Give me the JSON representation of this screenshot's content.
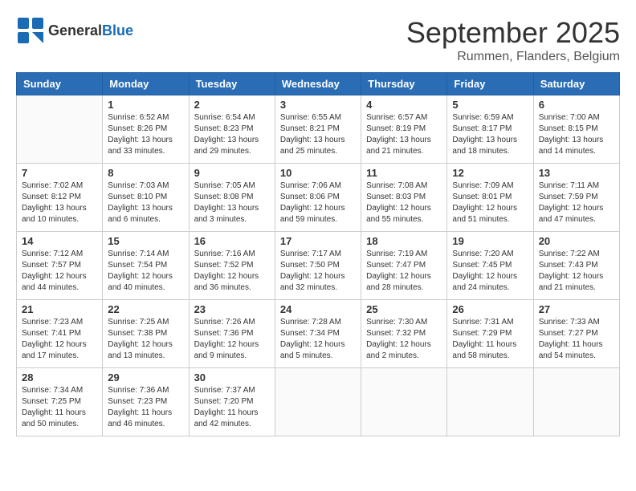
{
  "header": {
    "logo_line1": "General",
    "logo_line2": "Blue",
    "month": "September 2025",
    "location": "Rummen, Flanders, Belgium"
  },
  "columns": [
    "Sunday",
    "Monday",
    "Tuesday",
    "Wednesday",
    "Thursday",
    "Friday",
    "Saturday"
  ],
  "weeks": [
    [
      {
        "day": "",
        "info": ""
      },
      {
        "day": "1",
        "info": "Sunrise: 6:52 AM\nSunset: 8:26 PM\nDaylight: 13 hours\nand 33 minutes."
      },
      {
        "day": "2",
        "info": "Sunrise: 6:54 AM\nSunset: 8:23 PM\nDaylight: 13 hours\nand 29 minutes."
      },
      {
        "day": "3",
        "info": "Sunrise: 6:55 AM\nSunset: 8:21 PM\nDaylight: 13 hours\nand 25 minutes."
      },
      {
        "day": "4",
        "info": "Sunrise: 6:57 AM\nSunset: 8:19 PM\nDaylight: 13 hours\nand 21 minutes."
      },
      {
        "day": "5",
        "info": "Sunrise: 6:59 AM\nSunset: 8:17 PM\nDaylight: 13 hours\nand 18 minutes."
      },
      {
        "day": "6",
        "info": "Sunrise: 7:00 AM\nSunset: 8:15 PM\nDaylight: 13 hours\nand 14 minutes."
      }
    ],
    [
      {
        "day": "7",
        "info": "Sunrise: 7:02 AM\nSunset: 8:12 PM\nDaylight: 13 hours\nand 10 minutes."
      },
      {
        "day": "8",
        "info": "Sunrise: 7:03 AM\nSunset: 8:10 PM\nDaylight: 13 hours\nand 6 minutes."
      },
      {
        "day": "9",
        "info": "Sunrise: 7:05 AM\nSunset: 8:08 PM\nDaylight: 13 hours\nand 3 minutes."
      },
      {
        "day": "10",
        "info": "Sunrise: 7:06 AM\nSunset: 8:06 PM\nDaylight: 12 hours\nand 59 minutes."
      },
      {
        "day": "11",
        "info": "Sunrise: 7:08 AM\nSunset: 8:03 PM\nDaylight: 12 hours\nand 55 minutes."
      },
      {
        "day": "12",
        "info": "Sunrise: 7:09 AM\nSunset: 8:01 PM\nDaylight: 12 hours\nand 51 minutes."
      },
      {
        "day": "13",
        "info": "Sunrise: 7:11 AM\nSunset: 7:59 PM\nDaylight: 12 hours\nand 47 minutes."
      }
    ],
    [
      {
        "day": "14",
        "info": "Sunrise: 7:12 AM\nSunset: 7:57 PM\nDaylight: 12 hours\nand 44 minutes."
      },
      {
        "day": "15",
        "info": "Sunrise: 7:14 AM\nSunset: 7:54 PM\nDaylight: 12 hours\nand 40 minutes."
      },
      {
        "day": "16",
        "info": "Sunrise: 7:16 AM\nSunset: 7:52 PM\nDaylight: 12 hours\nand 36 minutes."
      },
      {
        "day": "17",
        "info": "Sunrise: 7:17 AM\nSunset: 7:50 PM\nDaylight: 12 hours\nand 32 minutes."
      },
      {
        "day": "18",
        "info": "Sunrise: 7:19 AM\nSunset: 7:47 PM\nDaylight: 12 hours\nand 28 minutes."
      },
      {
        "day": "19",
        "info": "Sunrise: 7:20 AM\nSunset: 7:45 PM\nDaylight: 12 hours\nand 24 minutes."
      },
      {
        "day": "20",
        "info": "Sunrise: 7:22 AM\nSunset: 7:43 PM\nDaylight: 12 hours\nand 21 minutes."
      }
    ],
    [
      {
        "day": "21",
        "info": "Sunrise: 7:23 AM\nSunset: 7:41 PM\nDaylight: 12 hours\nand 17 minutes."
      },
      {
        "day": "22",
        "info": "Sunrise: 7:25 AM\nSunset: 7:38 PM\nDaylight: 12 hours\nand 13 minutes."
      },
      {
        "day": "23",
        "info": "Sunrise: 7:26 AM\nSunset: 7:36 PM\nDaylight: 12 hours\nand 9 minutes."
      },
      {
        "day": "24",
        "info": "Sunrise: 7:28 AM\nSunset: 7:34 PM\nDaylight: 12 hours\nand 5 minutes."
      },
      {
        "day": "25",
        "info": "Sunrise: 7:30 AM\nSunset: 7:32 PM\nDaylight: 12 hours\nand 2 minutes."
      },
      {
        "day": "26",
        "info": "Sunrise: 7:31 AM\nSunset: 7:29 PM\nDaylight: 11 hours\nand 58 minutes."
      },
      {
        "day": "27",
        "info": "Sunrise: 7:33 AM\nSunset: 7:27 PM\nDaylight: 11 hours\nand 54 minutes."
      }
    ],
    [
      {
        "day": "28",
        "info": "Sunrise: 7:34 AM\nSunset: 7:25 PM\nDaylight: 11 hours\nand 50 minutes."
      },
      {
        "day": "29",
        "info": "Sunrise: 7:36 AM\nSunset: 7:23 PM\nDaylight: 11 hours\nand 46 minutes."
      },
      {
        "day": "30",
        "info": "Sunrise: 7:37 AM\nSunset: 7:20 PM\nDaylight: 11 hours\nand 42 minutes."
      },
      {
        "day": "",
        "info": ""
      },
      {
        "day": "",
        "info": ""
      },
      {
        "day": "",
        "info": ""
      },
      {
        "day": "",
        "info": ""
      }
    ]
  ]
}
